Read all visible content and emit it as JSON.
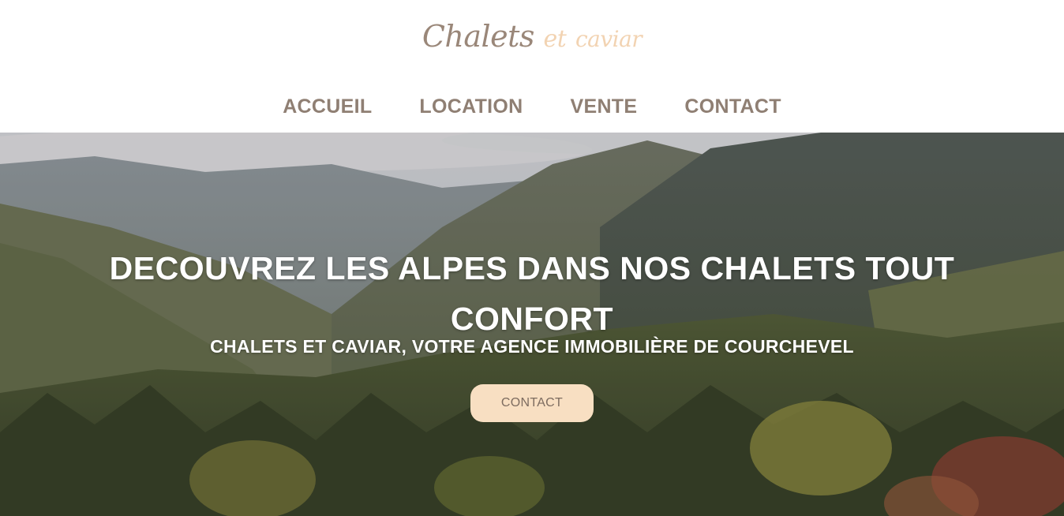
{
  "logo": {
    "word1": "Chalets",
    "word2": "et",
    "word3": "caviar"
  },
  "nav": {
    "items": [
      {
        "label": "ACCUEIL"
      },
      {
        "label": "LOCATION"
      },
      {
        "label": "VENTE"
      },
      {
        "label": "CONTACT"
      }
    ]
  },
  "hero": {
    "title": "DECOUVREZ LES ALPES DANS NOS CHALETS TOUT CONFORT",
    "subtitle": "CHALETS ET CAVIAR, VOTRE AGENCE IMMOBILIÈRE DE COURCHEVEL",
    "button_label": "CONTACT"
  },
  "colors": {
    "logo_primary": "#9a8779",
    "logo_accent": "#f2d3b2",
    "nav_text": "#8f7f73",
    "button_bg": "#f8dfc2",
    "button_text": "#7d6c60",
    "hero_text": "#ffffff"
  }
}
